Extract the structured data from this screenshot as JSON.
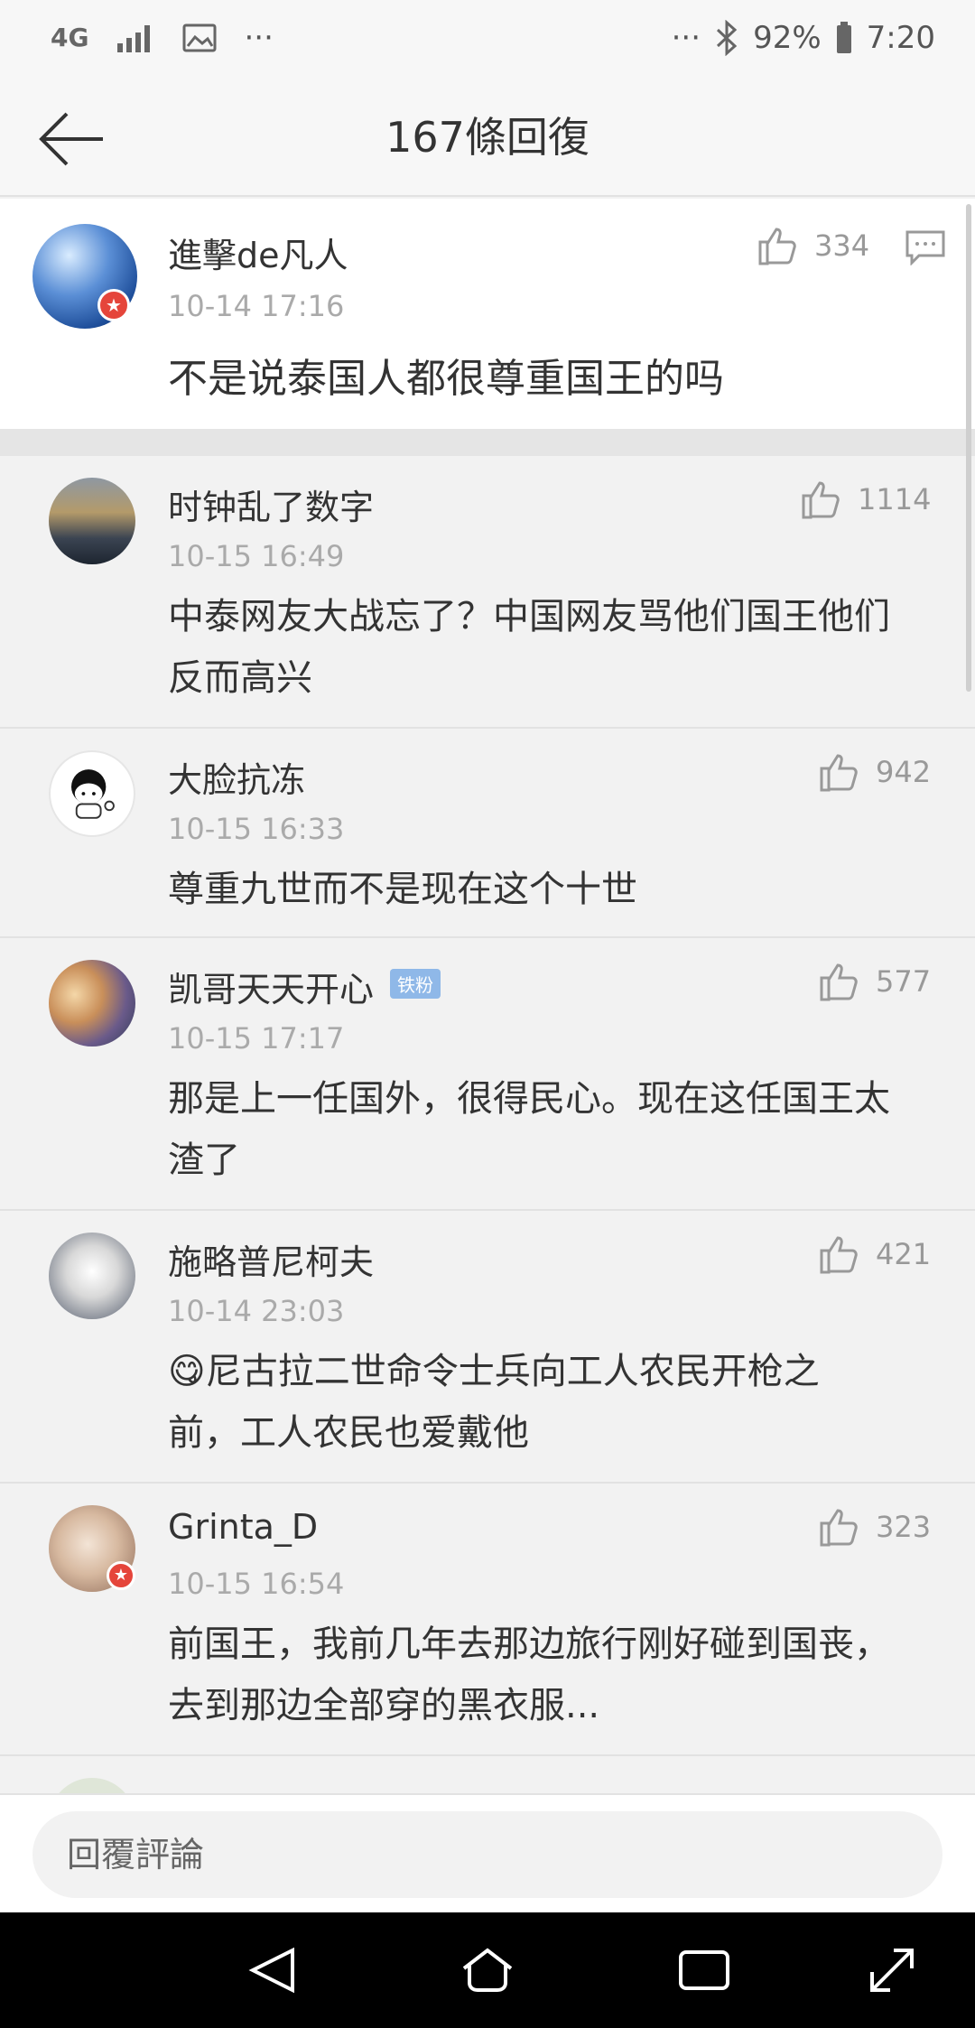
{
  "status_bar": {
    "network": "4G",
    "more": "···",
    "right_more": "···",
    "battery": "92%",
    "time": "7:20"
  },
  "header": {
    "title": "167條回復"
  },
  "main_post": {
    "username": "進擊de凡人",
    "time": "10-14 17:16",
    "text": "不是说泰国人都很尊重国王的吗",
    "likes": "334"
  },
  "comments": [
    {
      "username": "时钟乱了数字",
      "time": "10-15 16:49",
      "likes": "1114",
      "line1": "中泰网友大战忘了？中国网友骂他们国王他们",
      "line2": "反而高兴"
    },
    {
      "username": "大脸抗冻",
      "time": "10-15 16:33",
      "likes": "942",
      "line1": "尊重九世而不是现在这个十世",
      "line2": ""
    },
    {
      "username": "凯哥天天开心",
      "fan_tag": "铁粉",
      "time": "10-15 17:17",
      "likes": "577",
      "line1": "那是上一任国外，很得民心。现在这任国王太",
      "line2": "渣了"
    },
    {
      "username": "施略普尼柯夫",
      "time": "10-14 23:03",
      "likes": "421",
      "emoji": "😋",
      "line1": "尼古拉二世命令士兵向工人农民开枪之",
      "line2": "前，工人农民也爱戴他"
    },
    {
      "username": "Grinta_D",
      "time": "10-15 16:54",
      "likes": "323",
      "line1": "前国王，我前几年去那边旅行刚好碰到国丧，",
      "line2": "去到那边全部穿的黑衣服..."
    }
  ],
  "reply_bar": {
    "placeholder": "回覆評論"
  },
  "icons": {
    "back": "arrow-left-icon",
    "like": "thumbs-up-icon",
    "reply": "comment-icon"
  }
}
